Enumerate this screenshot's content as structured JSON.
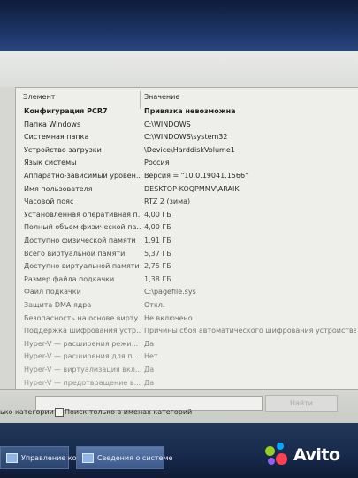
{
  "list": {
    "headers": {
      "element": "Элемент",
      "value": "Значение"
    },
    "rows": [
      {
        "key": "Конфигурация PCR7",
        "value": "Привязка невозможна",
        "bold": true
      },
      {
        "key": "Папка Windows",
        "value": "C:\\WINDOWS"
      },
      {
        "key": "Системная папка",
        "value": "C:\\WINDOWS\\system32"
      },
      {
        "key": "Устройство загрузки",
        "value": "\\Device\\HarddiskVolume1"
      },
      {
        "key": "Язык системы",
        "value": "Россия"
      },
      {
        "key": "Аппаратно-зависимый уровен...",
        "value": "Версия = \"10.0.19041.1566\""
      },
      {
        "key": "Имя пользователя",
        "value": "DESKTOP-KOQPMMV\\ARAIK"
      },
      {
        "key": "Часовой пояс",
        "value": "RTZ 2 (зима)"
      },
      {
        "key": "Установленная оперативная п...",
        "value": "4,00 ГБ"
      },
      {
        "key": "Полный объем физической па...",
        "value": "4,00 ГБ"
      },
      {
        "key": "Доступно физической памяти",
        "value": "1,91 ГБ"
      },
      {
        "key": "Всего виртуальной памяти",
        "value": "5,37 ГБ"
      },
      {
        "key": "Доступно виртуальной памяти",
        "value": "2,75 ГБ"
      },
      {
        "key": "Размер файла подкачки",
        "value": "1,38 ГБ"
      },
      {
        "key": "Файл подкачки",
        "value": "C:\\pagefile.sys"
      },
      {
        "key": "Защита DMA ядра",
        "value": "Откл."
      },
      {
        "key": "Безопасность на основе вирту...",
        "value": "Не включено"
      },
      {
        "key": "Поддержка шифрования устр...",
        "value": "Причины сбоя автоматического шифрования устройства: Д"
      },
      {
        "key": "Hyper-V — расширения режи...",
        "value": "Да"
      },
      {
        "key": "Hyper-V — расширения для п...",
        "value": "Нет"
      },
      {
        "key": "Hyper-V — виртуализация вкл...",
        "value": "Да"
      },
      {
        "key": "Hyper-V — предотвращение в...",
        "value": "Да"
      }
    ]
  },
  "bottom": {
    "categories_label": "ько категории",
    "search_names_label": "Поиск только в именах категорий",
    "find_button": "Найти"
  },
  "taskbar": {
    "items": [
      {
        "label": "Управление комп..."
      },
      {
        "label": "Сведения о системе"
      }
    ]
  },
  "watermark": {
    "text": "Avito"
  },
  "colors": {
    "avito_green": "#97cf26",
    "avito_blue": "#0af",
    "avito_red": "#ff4053",
    "avito_purple": "#965eeb"
  }
}
